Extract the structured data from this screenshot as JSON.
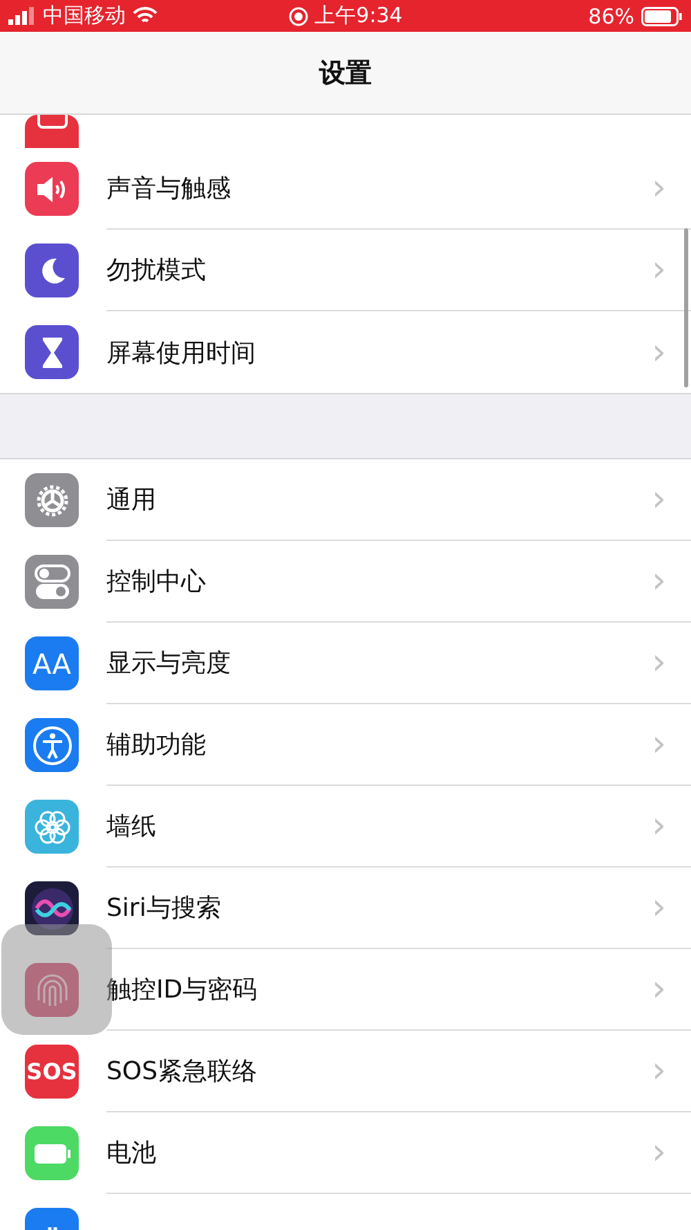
{
  "status_bar": {
    "carrier": "中国移动",
    "time": "上午9:34",
    "battery": "86%"
  },
  "nav": {
    "title": "设置"
  },
  "sections": [
    {
      "items": [
        {
          "kind": "notifications"
        },
        {
          "label": "声音与触感",
          "kind": "sounds"
        },
        {
          "label": "勿扰模式",
          "kind": "moon"
        },
        {
          "label": "屏幕使用时间",
          "kind": "hourglass"
        }
      ]
    },
    {
      "items": [
        {
          "label": "通用",
          "kind": "gear"
        },
        {
          "label": "控制中心",
          "kind": "toggles"
        },
        {
          "label": "显示与亮度",
          "kind": "textsize",
          "glyph": "AA"
        },
        {
          "label": "辅助功能",
          "kind": "accessibility"
        },
        {
          "label": "墙纸",
          "kind": "flower"
        },
        {
          "label": "Siri与搜索",
          "kind": "siri"
        },
        {
          "label": "触控ID与密码",
          "kind": "fingerprint"
        },
        {
          "label": "SOS紧急联络",
          "kind": "sos",
          "glyph": "SOS"
        },
        {
          "label": "电池",
          "kind": "battery"
        },
        {
          "kind": "hand"
        }
      ]
    }
  ],
  "chevron": "›"
}
